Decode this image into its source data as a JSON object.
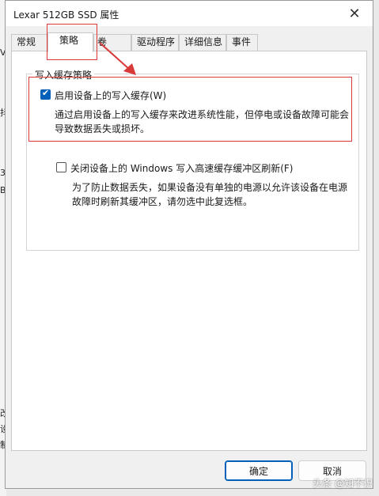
{
  "background": {
    "fragments": [
      "V",
      "抖",
      "3",
      "B",
      "改",
      "设",
      "制"
    ]
  },
  "dialog": {
    "title": "Lexar 512GB SSD 属性",
    "close_glyph": "✕",
    "tabs": [
      "常规",
      "策略",
      "卷",
      "驱动程序",
      "详细信息",
      "事件"
    ],
    "active_tab": "策略"
  },
  "policy": {
    "group_title": "写入缓存策略",
    "enable_cache": {
      "checked": true,
      "label": "启用设备上的写入缓存(W)",
      "desc_line1": "通过启用设备上的写入缓存来改进系统性能，但停电或设备故障可能会",
      "desc_line2": "导致数据丢失或损坏。"
    },
    "disable_flush": {
      "checked": false,
      "label": "关闭设备上的 Windows 写入高速缓存缓冲区刷新(F)",
      "desc_line1": "为了防止数据丢失，如果设备没有单独的电源以允许该设备在电源",
      "desc_line2": "故障时刷新其缓冲区，请勿选中此复选框。"
    }
  },
  "buttons": {
    "ok": "确定",
    "cancel": "取消"
  },
  "watermark": "头条 @知不识",
  "colors": {
    "accent": "#005fb8",
    "annotation": "#d83a3a"
  }
}
